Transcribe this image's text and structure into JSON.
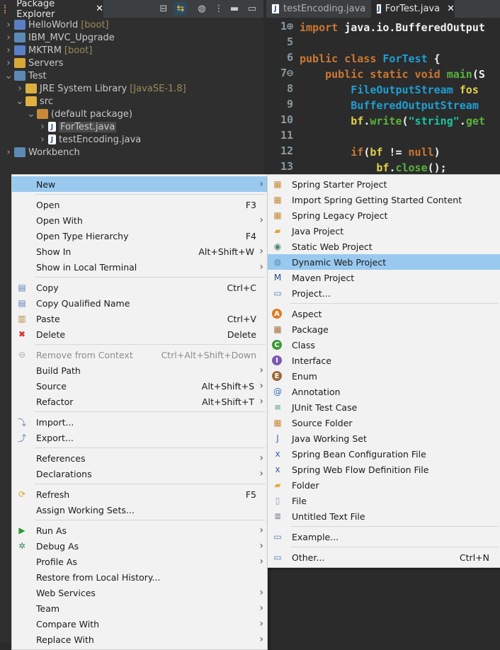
{
  "package_explorer": {
    "title": "Package Explorer",
    "close_glyph": "✕",
    "toolbar": [
      {
        "name": "collapse-all-icon",
        "glyph": "⊟"
      },
      {
        "name": "link-with-editor-icon",
        "glyph": "⇆"
      },
      {
        "name": "focus-on-active-task-icon",
        "glyph": "◍"
      },
      {
        "name": "view-menu-icon",
        "glyph": "⋮"
      },
      {
        "name": "minimize-icon",
        "glyph": "▬"
      },
      {
        "name": "maximize-icon",
        "glyph": "▭"
      }
    ],
    "tree": [
      {
        "label": "HelloWorld",
        "decoration": "[boot]",
        "expanded": false,
        "icon": "spring-project-icon"
      },
      {
        "label": "IBM_MVC_Upgrade",
        "decoration": "",
        "expanded": false,
        "icon": "web-project-warning-icon"
      },
      {
        "label": "MKTRM",
        "decoration": "[boot]",
        "expanded": false,
        "icon": "spring-project-error-icon"
      },
      {
        "label": "Servers",
        "decoration": "",
        "expanded": false,
        "icon": "folder-icon"
      },
      {
        "label": "Test",
        "decoration": "",
        "expanded": true,
        "icon": "java-project-icon"
      },
      {
        "label": "JRE System Library",
        "decoration": "[JavaSE-1.8]",
        "expanded": false,
        "icon": "library-icon"
      },
      {
        "label": "src",
        "decoration": "",
        "expanded": true,
        "icon": "source-folder-icon"
      },
      {
        "label": "(default package)",
        "decoration": "",
        "expanded": true,
        "icon": "package-icon"
      },
      {
        "label": "ForTest.java",
        "decoration": "",
        "expanded": false,
        "icon": "java-file-icon",
        "selected": true
      },
      {
        "label": "testEncoding.java",
        "decoration": "",
        "expanded": false,
        "icon": "java-file-icon"
      },
      {
        "label": "Workbench",
        "decoration": "",
        "expanded": false,
        "icon": "web-project-error-icon"
      }
    ]
  },
  "editor": {
    "tabs": [
      {
        "label": "testEncoding.java",
        "active": false
      },
      {
        "label": "ForTest.java",
        "active": true,
        "close_glyph": "✕"
      }
    ],
    "line_numbers": [
      "1⊕",
      "5",
      "6",
      "7⊖",
      "8",
      "9",
      "10",
      "11",
      "12",
      "13"
    ],
    "code_lines": [
      [
        {
          "t": "import ",
          "c": "kw"
        },
        {
          "t": "java.io.BufferedOutput",
          "c": "pun"
        }
      ],
      [],
      [
        {
          "t": "public class ",
          "c": "kw"
        },
        {
          "t": "ForTest",
          "c": "ty"
        },
        {
          "t": " {",
          "c": "pun"
        }
      ],
      [
        {
          "t": "    public static void ",
          "c": "kw"
        },
        {
          "t": "main",
          "c": "fn"
        },
        {
          "t": "(S",
          "c": "pun"
        }
      ],
      [
        {
          "t": "        FileOutputStream ",
          "c": "ty"
        },
        {
          "t": "fos",
          "c": "var"
        }
      ],
      [
        {
          "t": "        BufferedOutputStream",
          "c": "ty"
        }
      ],
      [
        {
          "t": "        bf",
          "c": "var"
        },
        {
          "t": ".",
          "c": "pun"
        },
        {
          "t": "write",
          "c": "fn"
        },
        {
          "t": "(",
          "c": "pun"
        },
        {
          "t": "\"string\"",
          "c": "str"
        },
        {
          "t": ".",
          "c": "pun"
        },
        {
          "t": "get",
          "c": "fn"
        }
      ],
      [],
      [
        {
          "t": "        if",
          "c": "kw"
        },
        {
          "t": "(",
          "c": "pun"
        },
        {
          "t": "bf",
          "c": "var"
        },
        {
          "t": " != ",
          "c": "pun"
        },
        {
          "t": "null",
          "c": "kw"
        },
        {
          "t": ")",
          "c": "pun"
        }
      ],
      [
        {
          "t": "            bf",
          "c": "var"
        },
        {
          "t": ".",
          "c": "pun"
        },
        {
          "t": "close",
          "c": "fn"
        },
        {
          "t": "();",
          "c": "pun"
        }
      ]
    ]
  },
  "context_menu": {
    "items": [
      {
        "type": "item",
        "label": "New",
        "arrow": true,
        "highlighted": true
      },
      {
        "type": "sep"
      },
      {
        "type": "item",
        "label": "Open",
        "shortcut": "F3"
      },
      {
        "type": "item",
        "label": "Open With",
        "arrow": true
      },
      {
        "type": "item",
        "label": "Open Type Hierarchy",
        "shortcut": "F4"
      },
      {
        "type": "item",
        "label": "Show In",
        "shortcut": "Alt+Shift+W",
        "arrow": true
      },
      {
        "type": "item",
        "label": "Show in Local Terminal",
        "arrow": true
      },
      {
        "type": "sep"
      },
      {
        "type": "item",
        "label": "Copy",
        "shortcut": "Ctrl+C",
        "icon": "copy-icon",
        "glyph": "▤",
        "color": "#5a7fb5"
      },
      {
        "type": "item",
        "label": "Copy Qualified Name",
        "icon": "copy-qualified-name-icon",
        "glyph": "▤",
        "color": "#5a7fb5"
      },
      {
        "type": "item",
        "label": "Paste",
        "shortcut": "Ctrl+V",
        "icon": "paste-icon",
        "glyph": "▥",
        "color": "#b88a3a"
      },
      {
        "type": "item",
        "label": "Delete",
        "shortcut": "Delete",
        "icon": "delete-icon",
        "glyph": "✖",
        "color": "#d8302a"
      },
      {
        "type": "sep"
      },
      {
        "type": "item",
        "label": "Remove from Context",
        "shortcut": "Ctrl+Alt+Shift+Down",
        "disabled": true,
        "icon": "remove-context-icon",
        "glyph": "⊖",
        "color": "#aaaaaa"
      },
      {
        "type": "item",
        "label": "Build Path",
        "arrow": true
      },
      {
        "type": "item",
        "label": "Source",
        "shortcut": "Alt+Shift+S",
        "arrow": true
      },
      {
        "type": "item",
        "label": "Refactor",
        "shortcut": "Alt+Shift+T",
        "arrow": true
      },
      {
        "type": "sep"
      },
      {
        "type": "item",
        "label": "Import...",
        "icon": "import-icon",
        "glyph": "⤵",
        "color": "#5a87b5"
      },
      {
        "type": "item",
        "label": "Export...",
        "icon": "export-icon",
        "glyph": "⤴",
        "color": "#5a87b5"
      },
      {
        "type": "sep"
      },
      {
        "type": "item",
        "label": "References",
        "arrow": true
      },
      {
        "type": "item",
        "label": "Declarations",
        "arrow": true
      },
      {
        "type": "sep"
      },
      {
        "type": "item",
        "label": "Refresh",
        "shortcut": "F5",
        "icon": "refresh-icon",
        "glyph": "⟳",
        "color": "#e0a020"
      },
      {
        "type": "item",
        "label": "Assign Working Sets..."
      },
      {
        "type": "sep"
      },
      {
        "type": "item",
        "label": "Run As",
        "arrow": true,
        "icon": "run-icon",
        "glyph": "▶",
        "color": "#2e9a2e"
      },
      {
        "type": "item",
        "label": "Debug As",
        "arrow": true,
        "icon": "debug-icon",
        "glyph": "✲",
        "color": "#3a8a5a"
      },
      {
        "type": "item",
        "label": "Profile As",
        "arrow": true
      },
      {
        "type": "item",
        "label": "Restore from Local History..."
      },
      {
        "type": "item",
        "label": "Web Services",
        "arrow": true
      },
      {
        "type": "item",
        "label": "Team",
        "arrow": true
      },
      {
        "type": "item",
        "label": "Compare With",
        "arrow": true
      },
      {
        "type": "item",
        "label": "Replace With",
        "arrow": true
      }
    ]
  },
  "new_submenu": {
    "items": [
      {
        "type": "item",
        "label": "Spring Starter Project",
        "icon": "spring-starter-project-icon",
        "glyph": "▦",
        "color": "#c9893a"
      },
      {
        "type": "item",
        "label": "Import Spring Getting Started Content",
        "icon": "spring-getting-started-icon",
        "glyph": "▦",
        "color": "#c9893a"
      },
      {
        "type": "item",
        "label": "Spring Legacy Project",
        "icon": "spring-legacy-project-icon",
        "glyph": "▦",
        "color": "#c9893a"
      },
      {
        "type": "item",
        "label": "Java Project",
        "icon": "java-project-icon",
        "glyph": "▰",
        "color": "#d9a83a"
      },
      {
        "type": "item",
        "label": "Static Web Project",
        "icon": "static-web-project-icon",
        "glyph": "◉",
        "color": "#4a8a6a"
      },
      {
        "type": "item",
        "label": "Dynamic Web Project",
        "icon": "dynamic-web-project-icon",
        "glyph": "◍",
        "color": "#5a8ab5",
        "highlighted": true
      },
      {
        "type": "item",
        "label": "Maven Project",
        "icon": "maven-project-icon",
        "glyph": "M",
        "color": "#2a4a8a"
      },
      {
        "type": "item",
        "label": "Project...",
        "icon": "project-icon",
        "glyph": "▭",
        "color": "#4a7ab5"
      },
      {
        "type": "sep"
      },
      {
        "type": "item",
        "label": "Aspect",
        "icon": "aspect-icon",
        "glyph": "A",
        "color": "#e07a20",
        "circle": true
      },
      {
        "type": "item",
        "label": "Package",
        "icon": "package-icon",
        "glyph": "▦",
        "color": "#a0703a"
      },
      {
        "type": "item",
        "label": "Class",
        "icon": "class-icon",
        "glyph": "C",
        "color": "#3a9a3a",
        "circle": true
      },
      {
        "type": "item",
        "label": "Interface",
        "icon": "interface-icon",
        "glyph": "I",
        "color": "#7a5ab5",
        "circle": true
      },
      {
        "type": "item",
        "label": "Enum",
        "icon": "enum-icon",
        "glyph": "E",
        "color": "#9a6a3a",
        "circle": true
      },
      {
        "type": "item",
        "label": "Annotation",
        "icon": "annotation-icon",
        "glyph": "@",
        "color": "#3a6ab5"
      },
      {
        "type": "item",
        "label": "JUnit Test Case",
        "icon": "junit-test-case-icon",
        "glyph": "≡",
        "color": "#4a9a6a"
      },
      {
        "type": "item",
        "label": "Source Folder",
        "icon": "source-folder-icon",
        "glyph": "▦",
        "color": "#c9893a"
      },
      {
        "type": "item",
        "label": "Java Working Set",
        "icon": "java-working-set-icon",
        "glyph": "J",
        "color": "#3a6ab5"
      },
      {
        "type": "item",
        "label": "Spring Bean Configuration File",
        "icon": "spring-bean-config-icon",
        "glyph": "x",
        "color": "#3a5a9a"
      },
      {
        "type": "item",
        "label": "Spring Web Flow Definition File",
        "icon": "spring-web-flow-icon",
        "glyph": "x",
        "color": "#3a5a9a"
      },
      {
        "type": "item",
        "label": "Folder",
        "icon": "folder-icon",
        "glyph": "▰",
        "color": "#e0b040"
      },
      {
        "type": "item",
        "label": "File",
        "icon": "file-icon",
        "glyph": "▯",
        "color": "#8aa0b5"
      },
      {
        "type": "item",
        "label": "Untitled Text File",
        "icon": "text-file-icon",
        "glyph": "≣",
        "color": "#6a7a8a"
      },
      {
        "type": "sep"
      },
      {
        "type": "item",
        "label": "Example...",
        "icon": "example-icon",
        "glyph": "▭",
        "color": "#4a7ab5"
      },
      {
        "type": "sep"
      },
      {
        "type": "item",
        "label": "Other...",
        "shortcut": "Ctrl+N",
        "icon": "other-wizard-icon",
        "glyph": "▭",
        "color": "#4a7ab5"
      }
    ]
  }
}
